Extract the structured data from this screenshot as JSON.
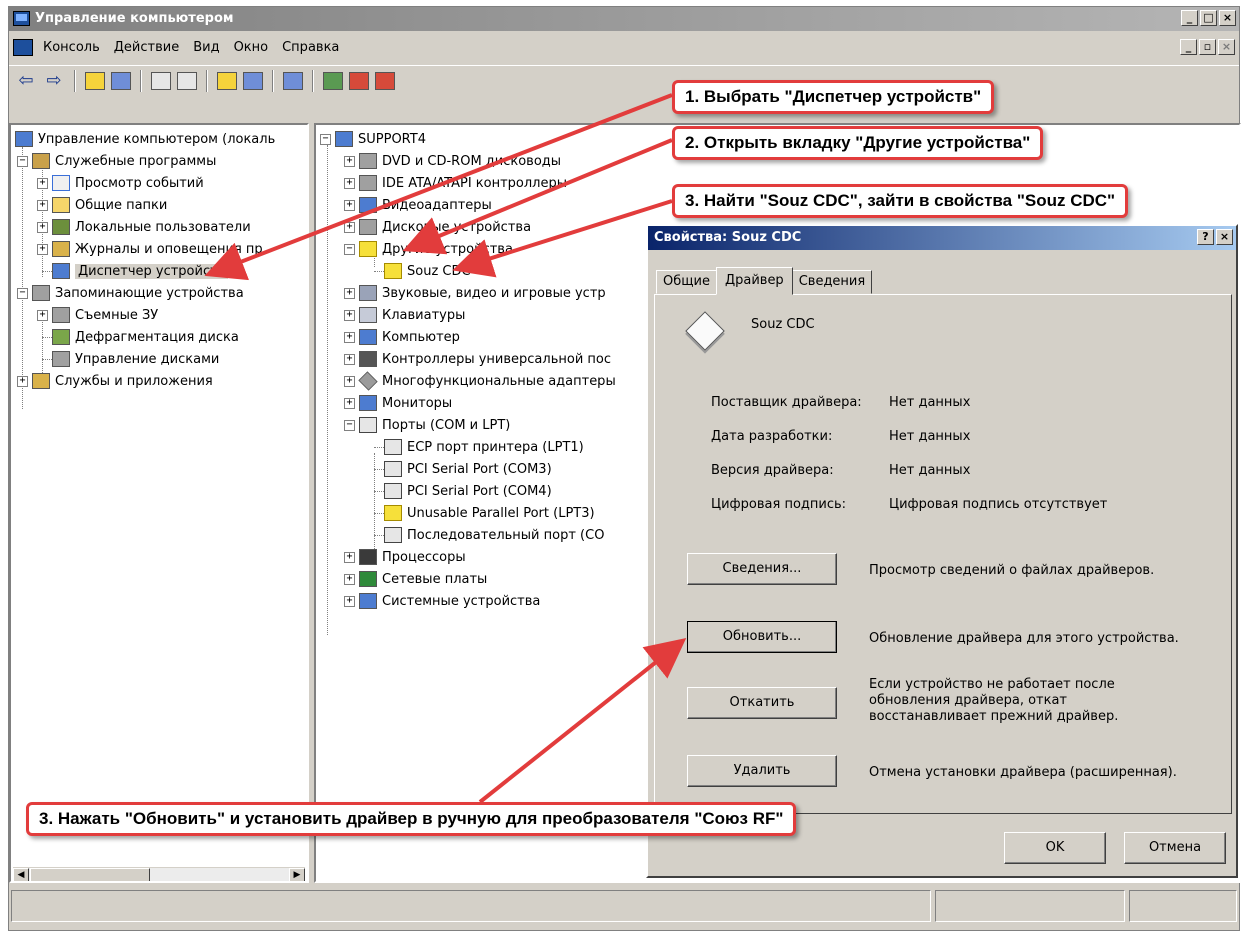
{
  "window": {
    "title": "Управление компьютером"
  },
  "menu": [
    "Консоль",
    "Действие",
    "Вид",
    "Окно",
    "Справка"
  ],
  "left_tree": [
    {
      "label": "Управление компьютером (локаль",
      "icon": "computer-icon"
    },
    {
      "label": "Служебные программы",
      "icon": "tools-icon"
    },
    {
      "label": "Просмотр событий",
      "icon": "event-viewer-icon"
    },
    {
      "label": "Общие папки",
      "icon": "folder-icon"
    },
    {
      "label": "Локальные пользователи",
      "icon": "users-icon"
    },
    {
      "label": "Журналы и оповещения пр",
      "icon": "logs-icon"
    },
    {
      "label": "Диспетчер устройств",
      "icon": "device-manager-icon"
    },
    {
      "label": "Запоминающие устройства",
      "icon": "storage-icon"
    },
    {
      "label": "Съемные ЗУ",
      "icon": "removable-storage-icon"
    },
    {
      "label": "Дефрагментация диска",
      "icon": "defrag-icon"
    },
    {
      "label": "Управление дисками",
      "icon": "disk-management-icon"
    },
    {
      "label": "Службы и приложения",
      "icon": "services-icon"
    }
  ],
  "right_tree": [
    {
      "label": "SUPPORT4",
      "icon": "computer-icon"
    },
    {
      "label": "DVD и CD-ROM дисководы",
      "icon": "cdrom-icon"
    },
    {
      "label": "IDE ATA/ATAPI контроллеры",
      "icon": "ide-icon"
    },
    {
      "label": "Видеоадаптеры",
      "icon": "display-adapter-icon"
    },
    {
      "label": "Дисковые устройства",
      "icon": "disk-drive-icon"
    },
    {
      "label": "Другие устройства",
      "icon": "other-devices-icon"
    },
    {
      "label": "Souz CDC",
      "icon": "unknown-device-icon"
    },
    {
      "label": "Звуковые, видео и игровые устр",
      "icon": "sound-icon"
    },
    {
      "label": "Клавиатуры",
      "icon": "keyboard-icon"
    },
    {
      "label": "Компьютер",
      "icon": "computer-icon"
    },
    {
      "label": "Контроллеры универсальной пос",
      "icon": "usb-icon"
    },
    {
      "label": "Многофункциональные адаптеры",
      "icon": "multifunction-icon"
    },
    {
      "label": "Мониторы",
      "icon": "monitor-icon"
    },
    {
      "label": "Порты (COM и LPT)",
      "icon": "ports-icon"
    },
    {
      "label": "ECP порт принтера (LPT1)",
      "icon": "port-icon"
    },
    {
      "label": "PCI Serial Port (COM3)",
      "icon": "port-icon"
    },
    {
      "label": "PCI Serial Port (COM4)",
      "icon": "port-icon"
    },
    {
      "label": "Unusable Parallel Port (LPT3)",
      "icon": "port-warning-icon"
    },
    {
      "label": "Последовательный порт (CO",
      "icon": "port-icon"
    },
    {
      "label": "Процессоры",
      "icon": "cpu-icon"
    },
    {
      "label": "Сетевые платы",
      "icon": "network-card-icon"
    },
    {
      "label": "Системные устройства",
      "icon": "system-devices-icon"
    }
  ],
  "dialog": {
    "title": "Свойства: Souz CDC",
    "tabs": [
      "Общие",
      "Драйвер",
      "Сведения"
    ],
    "device_name": "Souz CDC",
    "info": [
      {
        "label": "Поставщик драйвера:",
        "value": "Нет данных"
      },
      {
        "label": "Дата разработки:",
        "value": "Нет данных"
      },
      {
        "label": "Версия драйвера:",
        "value": "Нет данных"
      },
      {
        "label": "Цифровая подпись:",
        "value": "Цифровая подпись отсутствует"
      }
    ],
    "buttons": [
      {
        "label": "Сведения...",
        "desc": "Просмотр сведений о файлах драйверов."
      },
      {
        "label": "Обновить...",
        "desc": "Обновление драйвера для этого устройства."
      },
      {
        "label": "Откатить",
        "desc": "Если устройство не работает после обновления драйвера, откат восстанавливает прежний драйвер."
      },
      {
        "label": "Удалить",
        "desc": "Отмена установки драйвера (расширенная)."
      }
    ],
    "ok": "OK",
    "cancel": "Отмена"
  },
  "callouts": {
    "c1": "1. Выбрать \"Диспетчер устройств\"",
    "c2": "2. Открыть вкладку \"Другие устройства\"",
    "c3": "3. Найти \"Souz CDC\", зайти в свойства \"Souz CDC\"",
    "c4": "3. Нажать \"Обновить\" и установить драйвер в ручную для преобразователя \"Союз RF\""
  },
  "colors": {
    "callout_border": "#e23c3c",
    "dialog_title": "#0a246a"
  }
}
